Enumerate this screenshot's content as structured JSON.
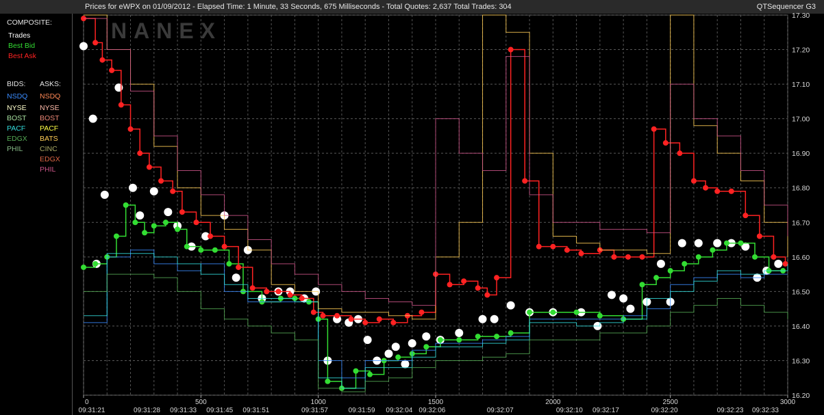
{
  "header": {
    "title": "Prices for  eWPX  on  01/09/2012  -  Elapsed Time: 1 Minute, 33 Seconds, 675 Milliseconds  -  Total Quotes: 2,637  Total Trades: 304",
    "app_name": "QTSequencer G3"
  },
  "watermark": "NANEX",
  "legend": {
    "composite_label": "COMPOSITE:",
    "composite": [
      {
        "label": "Trades",
        "color": "#ffffff"
      },
      {
        "label": "Best Bid",
        "color": "#33dd33"
      },
      {
        "label": "Best Ask",
        "color": "#ff2222"
      }
    ],
    "bids_label": "BIDS:",
    "asks_label": "ASKS:",
    "bids": [
      {
        "label": "NSDQ",
        "color": "#3b8cff"
      },
      {
        "label": "NYSE",
        "color": "#ffffcc"
      },
      {
        "label": "BOST",
        "color": "#a8e0a0"
      },
      {
        "label": "PACF",
        "color": "#33dddd"
      },
      {
        "label": "EDGX",
        "color": "#55aa55"
      },
      {
        "label": "PHIL",
        "color": "#88bb88"
      }
    ],
    "asks": [
      {
        "label": "NSDQ",
        "color": "#ff8855"
      },
      {
        "label": "NYSE",
        "color": "#ffbbaa"
      },
      {
        "label": "BOST",
        "color": "#ee8877"
      },
      {
        "label": "PACF",
        "color": "#ffff44"
      },
      {
        "label": "BATS",
        "color": "#ffcc55"
      },
      {
        "label": "CINC",
        "color": "#aaaa66"
      },
      {
        "label": "EDGX",
        "color": "#dd6644"
      },
      {
        "label": "PHIL",
        "color": "#cc5588"
      }
    ]
  },
  "chart_data": {
    "type": "line",
    "xlim": [
      0,
      3000
    ],
    "ylim": [
      16.2,
      17.3
    ],
    "x_ticks": [
      0,
      500,
      1000,
      1500,
      2000,
      2500,
      3000
    ],
    "x_tick_labels": [
      "0",
      "500",
      "1000",
      "1500",
      "2000",
      "2500",
      "3000"
    ],
    "time_labels": [
      {
        "x": 0,
        "label": "09:31:21"
      },
      {
        "x": 270,
        "label": "09:31:28"
      },
      {
        "x": 425,
        "label": "09:31:33"
      },
      {
        "x": 580,
        "label": "09:31:45"
      },
      {
        "x": 735,
        "label": "09:31:51"
      },
      {
        "x": 985,
        "label": "09:31:57"
      },
      {
        "x": 1185,
        "label": "09:31:59"
      },
      {
        "x": 1345,
        "label": "09:32:04"
      },
      {
        "x": 1485,
        "label": "09:32:06"
      },
      {
        "x": 1775,
        "label": "09:32:07"
      },
      {
        "x": 2070,
        "label": "09:32:10"
      },
      {
        "x": 2225,
        "label": "09:32:17"
      },
      {
        "x": 2475,
        "label": "09:32:20"
      },
      {
        "x": 2755,
        "label": "09:32:23"
      },
      {
        "x": 2905,
        "label": "09:32:33"
      }
    ],
    "y_ticks": [
      16.2,
      16.3,
      16.4,
      16.5,
      16.6,
      16.7,
      16.8,
      16.9,
      17.0,
      17.1,
      17.2,
      17.3
    ],
    "y_tick_labels": [
      "16.20",
      "16.30",
      "16.40",
      "16.50",
      "16.60",
      "16.70",
      "16.80",
      "16.90",
      "17.00",
      "17.10",
      "17.20",
      "17.30"
    ],
    "grid": true,
    "series": [
      {
        "name": "Trades",
        "color": "#ffffff",
        "x": [
          0,
          40,
          55,
          90,
          150,
          210,
          240,
          300,
          360,
          400,
          460,
          520,
          600,
          650,
          700,
          760,
          830,
          880,
          940,
          990,
          1040,
          1080,
          1130,
          1170,
          1210,
          1250,
          1300,
          1330,
          1370,
          1400,
          1460,
          1520,
          1600,
          1700,
          1750,
          1820,
          1900,
          2000,
          2120,
          2190,
          2250,
          2300,
          2330,
          2400,
          2460,
          2500,
          2550,
          2620,
          2700,
          2760,
          2820,
          2870,
          2910,
          2960
        ],
        "y": [
          17.21,
          17.0,
          16.58,
          16.78,
          17.09,
          16.8,
          16.72,
          16.79,
          16.73,
          16.69,
          16.63,
          16.66,
          16.72,
          16.54,
          16.62,
          16.48,
          16.5,
          16.5,
          16.48,
          16.5,
          16.3,
          16.42,
          16.41,
          16.42,
          16.36,
          16.3,
          16.32,
          16.34,
          16.29,
          16.35,
          16.37,
          16.36,
          16.38,
          16.42,
          16.42,
          16.46,
          16.44,
          16.44,
          16.44,
          16.4,
          16.49,
          16.48,
          16.45,
          16.47,
          16.58,
          16.47,
          16.64,
          16.64,
          16.64,
          16.64,
          16.63,
          16.54,
          16.56,
          16.58
        ]
      },
      {
        "name": "Best Bid",
        "color": "#33dd33",
        "x": [
          0,
          50,
          100,
          140,
          180,
          220,
          260,
          300,
          350,
          400,
          440,
          500,
          560,
          620,
          680,
          760,
          840,
          900,
          960,
          1000,
          1040,
          1100,
          1160,
          1220,
          1280,
          1340,
          1400,
          1460,
          1520,
          1600,
          1680,
          1760,
          1820,
          1900,
          2000,
          2100,
          2200,
          2300,
          2380,
          2440,
          2500,
          2560,
          2620,
          2680,
          2740,
          2800,
          2860,
          2920,
          2980
        ],
        "y": [
          16.57,
          16.58,
          16.6,
          16.66,
          16.75,
          16.7,
          16.67,
          16.69,
          16.7,
          16.68,
          16.63,
          16.62,
          16.62,
          16.58,
          16.5,
          16.47,
          16.48,
          16.48,
          16.47,
          16.42,
          16.24,
          16.22,
          16.27,
          16.26,
          16.3,
          16.31,
          16.32,
          16.34,
          16.36,
          16.36,
          16.37,
          16.37,
          16.38,
          16.44,
          16.44,
          16.44,
          16.43,
          16.42,
          16.52,
          16.54,
          16.56,
          16.58,
          16.6,
          16.62,
          16.64,
          16.64,
          16.6,
          16.56,
          16.56
        ]
      },
      {
        "name": "Best Ask",
        "color": "#ff2222",
        "x": [
          0,
          50,
          80,
          120,
          160,
          200,
          240,
          280,
          330,
          380,
          420,
          480,
          540,
          600,
          660,
          720,
          780,
          830,
          880,
          930,
          980,
          1020,
          1080,
          1140,
          1200,
          1260,
          1320,
          1380,
          1440,
          1500,
          1560,
          1620,
          1680,
          1720,
          1760,
          1820,
          1880,
          1940,
          2000,
          2060,
          2120,
          2200,
          2260,
          2320,
          2380,
          2430,
          2480,
          2540,
          2600,
          2650,
          2700,
          2760,
          2820,
          2880,
          2940,
          2990
        ],
        "y": [
          17.29,
          17.22,
          17.17,
          17.14,
          17.04,
          16.97,
          16.9,
          16.86,
          16.82,
          16.79,
          16.73,
          16.7,
          16.66,
          16.63,
          16.57,
          16.51,
          16.5,
          16.5,
          16.49,
          16.48,
          16.44,
          16.43,
          16.43,
          16.42,
          16.41,
          16.42,
          16.41,
          16.43,
          16.44,
          16.55,
          16.52,
          16.53,
          16.51,
          16.49,
          16.54,
          17.2,
          16.82,
          16.63,
          16.63,
          16.62,
          16.61,
          16.62,
          16.6,
          16.6,
          16.6,
          16.97,
          16.93,
          16.9,
          16.82,
          16.8,
          16.79,
          16.79,
          16.72,
          16.66,
          16.6,
          16.58
        ]
      },
      {
        "name": "NSDQ",
        "color": "#3b8cff",
        "x": [
          0,
          100,
          200,
          300,
          400,
          500,
          600,
          700,
          800,
          900,
          1000,
          1100,
          1200,
          1300,
          1400,
          1500,
          1600,
          1700,
          1800,
          1900,
          2000,
          2100,
          2200,
          2300,
          2400,
          2500,
          2600,
          2700,
          2800,
          2900,
          3000
        ],
        "y": [
          16.41,
          16.6,
          16.62,
          16.58,
          16.56,
          16.58,
          16.5,
          16.47,
          16.47,
          16.47,
          16.3,
          16.25,
          16.3,
          16.3,
          16.33,
          16.35,
          16.35,
          16.36,
          16.37,
          16.42,
          16.42,
          16.42,
          16.42,
          16.43,
          16.45,
          16.52,
          16.54,
          16.55,
          16.54,
          16.55,
          16.55
        ]
      },
      {
        "name": "PACF",
        "color": "#33dddd",
        "x": [
          0,
          100,
          200,
          300,
          400,
          500,
          600,
          700,
          800,
          900,
          1000,
          1100,
          1200,
          1300,
          1400,
          1500,
          1600,
          1700,
          1800,
          1900,
          2000,
          2100,
          2200,
          2300,
          2400,
          2500,
          2600,
          2700,
          2800,
          2900,
          3000
        ],
        "y": [
          16.43,
          16.61,
          16.61,
          16.6,
          16.58,
          16.55,
          16.52,
          16.48,
          16.48,
          16.47,
          16.25,
          16.22,
          16.28,
          16.28,
          16.31,
          16.34,
          16.34,
          16.35,
          16.36,
          16.41,
          16.41,
          16.4,
          16.41,
          16.42,
          16.48,
          16.5,
          16.53,
          16.56,
          16.55,
          16.56,
          16.58
        ]
      },
      {
        "name": "BATS",
        "color": "#ffcc55",
        "x": [
          0,
          100,
          200,
          300,
          400,
          500,
          600,
          700,
          800,
          900,
          1000,
          1100,
          1200,
          1300,
          1400,
          1500,
          1600,
          1700,
          1800,
          1900,
          2000,
          2100,
          2200,
          2300,
          2400,
          2500,
          2600,
          2700,
          2800,
          2900,
          3000
        ],
        "y": [
          17.3,
          17.2,
          17.1,
          16.92,
          16.8,
          16.72,
          16.68,
          16.62,
          16.52,
          16.5,
          16.45,
          16.44,
          16.44,
          16.43,
          16.42,
          16.6,
          16.7,
          17.3,
          17.25,
          16.9,
          16.66,
          16.64,
          16.62,
          16.62,
          16.61,
          17.3,
          16.98,
          16.9,
          16.82,
          16.7,
          16.6
        ]
      },
      {
        "name": "PHIL",
        "color": "#cc5588",
        "x": [
          0,
          100,
          200,
          300,
          400,
          500,
          600,
          700,
          800,
          900,
          1000,
          1100,
          1200,
          1300,
          1400,
          1500,
          1600,
          1700,
          1800,
          1900,
          2000,
          2100,
          2200,
          2300,
          2400,
          2500,
          2600,
          2700,
          2800,
          2900,
          3000
        ],
        "y": [
          17.29,
          17.2,
          17.08,
          16.95,
          16.85,
          16.78,
          16.72,
          16.65,
          16.58,
          16.55,
          16.52,
          16.5,
          16.48,
          16.47,
          16.46,
          17.0,
          16.9,
          16.85,
          17.18,
          16.78,
          16.7,
          16.7,
          16.68,
          16.68,
          16.67,
          17.1,
          17.0,
          16.95,
          16.85,
          16.75,
          16.66
        ]
      },
      {
        "name": "EDGX",
        "color": "#55aa55",
        "x": [
          0,
          100,
          200,
          300,
          400,
          500,
          600,
          700,
          800,
          900,
          1000,
          1100,
          1200,
          1300,
          1400,
          1500,
          1600,
          1700,
          1800,
          1900,
          2000,
          2100,
          2200,
          2300,
          2400,
          2500,
          2600,
          2700,
          2800,
          2900,
          3000
        ],
        "y": [
          16.5,
          16.55,
          16.55,
          16.54,
          16.5,
          16.45,
          16.42,
          16.4,
          16.38,
          16.36,
          16.22,
          16.21,
          16.24,
          16.25,
          16.28,
          16.3,
          16.3,
          16.31,
          16.32,
          16.36,
          16.36,
          16.36,
          16.38,
          16.38,
          16.4,
          16.44,
          16.46,
          16.48,
          16.46,
          16.44,
          16.42
        ]
      }
    ]
  }
}
